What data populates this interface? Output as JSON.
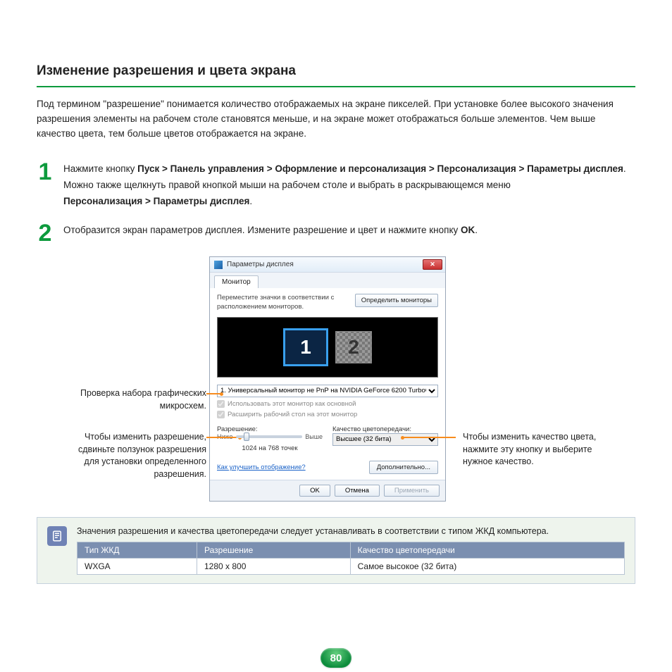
{
  "heading": "Изменение разрешения и цвета экрана",
  "intro": "Под термином \"разрешение\" понимается количество отображаемых на экране пикселей. При установке более высокого значения разрешения элементы на рабочем столе становятся меньше, и на экране может отображаться больше элементов. Чем выше качество цвета, тем больше цветов отображается на экране.",
  "step1": {
    "num": "1",
    "lead": "Нажмите кнопку ",
    "path": "Пуск > Панель управления > Оформление и персонализация > Персонализация > Параметры дисплея",
    "dot": ".",
    "line2a": "Можно также щелкнуть правой кнопкой мыши на рабочем столе и выбрать в раскрывающемся меню ",
    "line2b": "Персонализация > Параметры дисплея",
    "line2c": "."
  },
  "step2": {
    "num": "2",
    "text_a": "Отобразится экран параметров дисплея. Измените разрешение и цвет и нажмите кнопку ",
    "text_b": "OK",
    "text_c": "."
  },
  "callouts": {
    "left1": "Проверка набора графических микросхем.",
    "left2": "Чтобы изменить разрешение, сдвиньте ползунок разрешения для установки определенного разрешения.",
    "right1": "Чтобы изменить качество цвета, нажмите эту кнопку и выберите нужное качество."
  },
  "dialog": {
    "title": "Параметры дисплея",
    "tab": "Монитор",
    "instruction": "Переместите значки в соответствии с расположением мониторов.",
    "identify": "Определить мониторы",
    "mon1": "1",
    "mon2": "2",
    "select_value": "1. Универсальный монитор не PnP на NVIDIA GeForce 6200 TurboCache( ▾",
    "chk1": "Использовать этот монитор как основной",
    "chk2": "Расширить рабочий стол на этот монитор",
    "res_label": "Разрешение:",
    "res_low": "Ниже",
    "res_high": "Выше",
    "res_value": "1024 на 768 точек",
    "quality_label": "Качество цветопередачи:",
    "quality_value": "Высшее (32 бита)",
    "link": "Как улучшить отображение?",
    "advanced": "Дополнительно...",
    "ok": "OK",
    "cancel": "Отмена",
    "apply": "Применить"
  },
  "note": {
    "text": "Значения разрешения и качества цветопередачи следует устанавливать в соответствии с типом ЖКД компьютера.",
    "headers": {
      "c1": "Тип ЖКД",
      "c2": "Разрешение",
      "c3": "Качество цветопередачи"
    },
    "row": {
      "c1": "WXGA",
      "c2": "1280 x 800",
      "c3": "Самое высокое (32 бита)"
    }
  },
  "page_number": "80"
}
